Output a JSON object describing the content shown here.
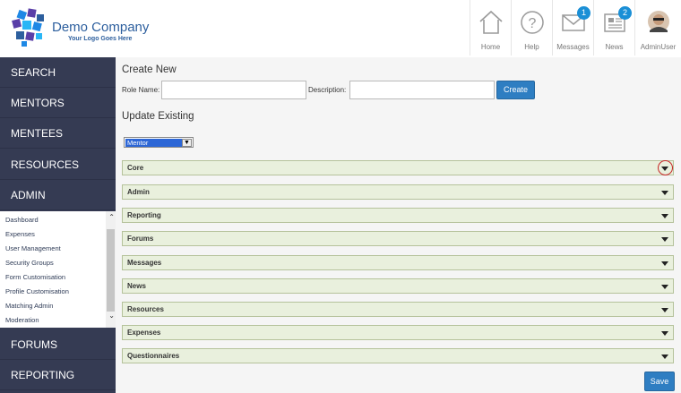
{
  "brand": {
    "name": "Demo Company",
    "tagline": "Your Logo Goes Here"
  },
  "header_nav": [
    {
      "label": "Home",
      "icon": "home-icon"
    },
    {
      "label": "Help",
      "icon": "help-icon"
    },
    {
      "label": "Messages",
      "icon": "envelope-icon",
      "badge": "1"
    },
    {
      "label": "News",
      "icon": "newspaper-icon",
      "badge": "2"
    },
    {
      "label": "AdminUser",
      "icon": "avatar"
    }
  ],
  "sidebar": {
    "items": [
      "SEARCH",
      "MENTORS",
      "MENTEES",
      "RESOURCES",
      "ADMIN"
    ],
    "admin_submenu": [
      "Dashboard",
      "Expenses",
      "User Management",
      "Security Groups",
      "Form Customisation",
      "Profile Customisation",
      "Matching Admin",
      "Moderation"
    ],
    "bottom_items": [
      "FORUMS",
      "REPORTING"
    ]
  },
  "create": {
    "title": "Create New",
    "role_label": "Role Name:",
    "role_value": "",
    "desc_label": "Description:",
    "desc_value": "",
    "button": "Create"
  },
  "update": {
    "title": "Update Existing",
    "role_select": "Mentor",
    "sections": [
      "Core",
      "Admin",
      "Reporting",
      "Forums",
      "Messages",
      "News",
      "Resources",
      "Expenses",
      "Questionnaires"
    ],
    "save_button": "Save"
  },
  "colors": {
    "sidebar": "#353b53",
    "accent": "#2e7ec2",
    "accordion": "#e9f0dd",
    "highlight_ring": "#c62828"
  }
}
